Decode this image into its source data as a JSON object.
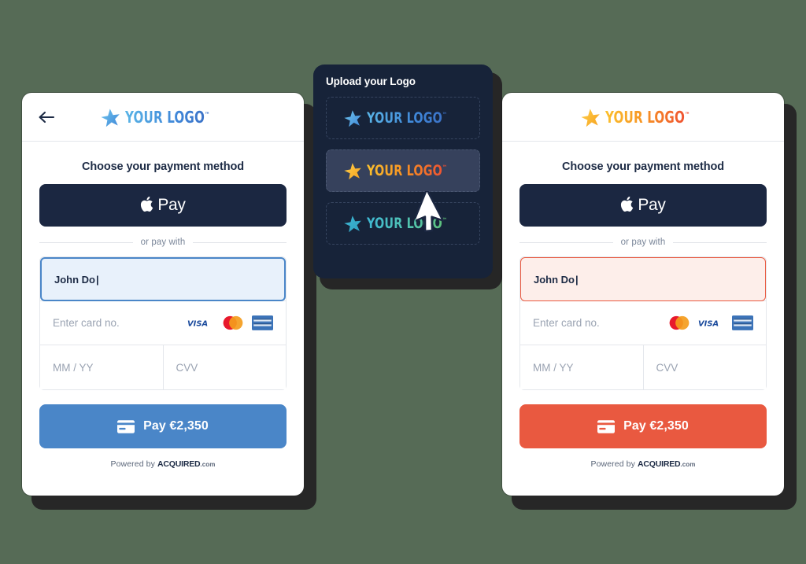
{
  "background_color": "#566b56",
  "left_card": {
    "theme_color": "#4a86c8",
    "back_icon": "back-arrow-icon",
    "logo": {
      "text": "YOUR LOGO",
      "tm": "™",
      "variant": "blue",
      "icon": "star-icon"
    },
    "section_title": "Choose your payment method",
    "apple_pay": {
      "glyph": "",
      "label": "Pay"
    },
    "divider_label": "or pay with",
    "fields": {
      "name_value": "John Do",
      "card_placeholder": "Enter card no.",
      "expiry_placeholder": "MM / YY",
      "cvv_placeholder": "CVV"
    },
    "card_brands": [
      "visa-icon",
      "mastercard-icon",
      "amex-icon"
    ],
    "pay_button": {
      "label": "Pay €2,350",
      "icon": "credit-card-icon"
    },
    "footer": {
      "prefix": "Powered by",
      "brand": "ACQUIRED",
      "suffix": ".com"
    }
  },
  "upload_panel": {
    "title": "Upload your Logo",
    "options": [
      {
        "text": "YOUR LOGO",
        "tm": "™",
        "variant": "blue",
        "selected": false
      },
      {
        "text": "YOUR LOGO",
        "tm": "™",
        "variant": "warm",
        "selected": true
      },
      {
        "text": "YOUR LOGO",
        "tm": "™",
        "variant": "teal",
        "selected": false
      }
    ],
    "cursor": "mouse-pointer"
  },
  "right_card": {
    "theme_color": "#e95940",
    "logo": {
      "text": "YOUR LOGO",
      "tm": "™",
      "variant": "warm",
      "icon": "star-icon"
    },
    "section_title": "Choose your payment method",
    "apple_pay": {
      "glyph": "",
      "label": "Pay"
    },
    "divider_label": "or pay with",
    "fields": {
      "name_value": "John Do",
      "card_placeholder": "Enter card no.",
      "expiry_placeholder": "MM / YY",
      "cvv_placeholder": "CVV"
    },
    "card_brands": [
      "mastercard-icon",
      "visa-icon",
      "amex-icon"
    ],
    "pay_button": {
      "label": "Pay €2,350",
      "icon": "credit-card-icon"
    },
    "footer": {
      "prefix": "Powered by",
      "brand": "ACQUIRED",
      "suffix": ".com"
    }
  }
}
